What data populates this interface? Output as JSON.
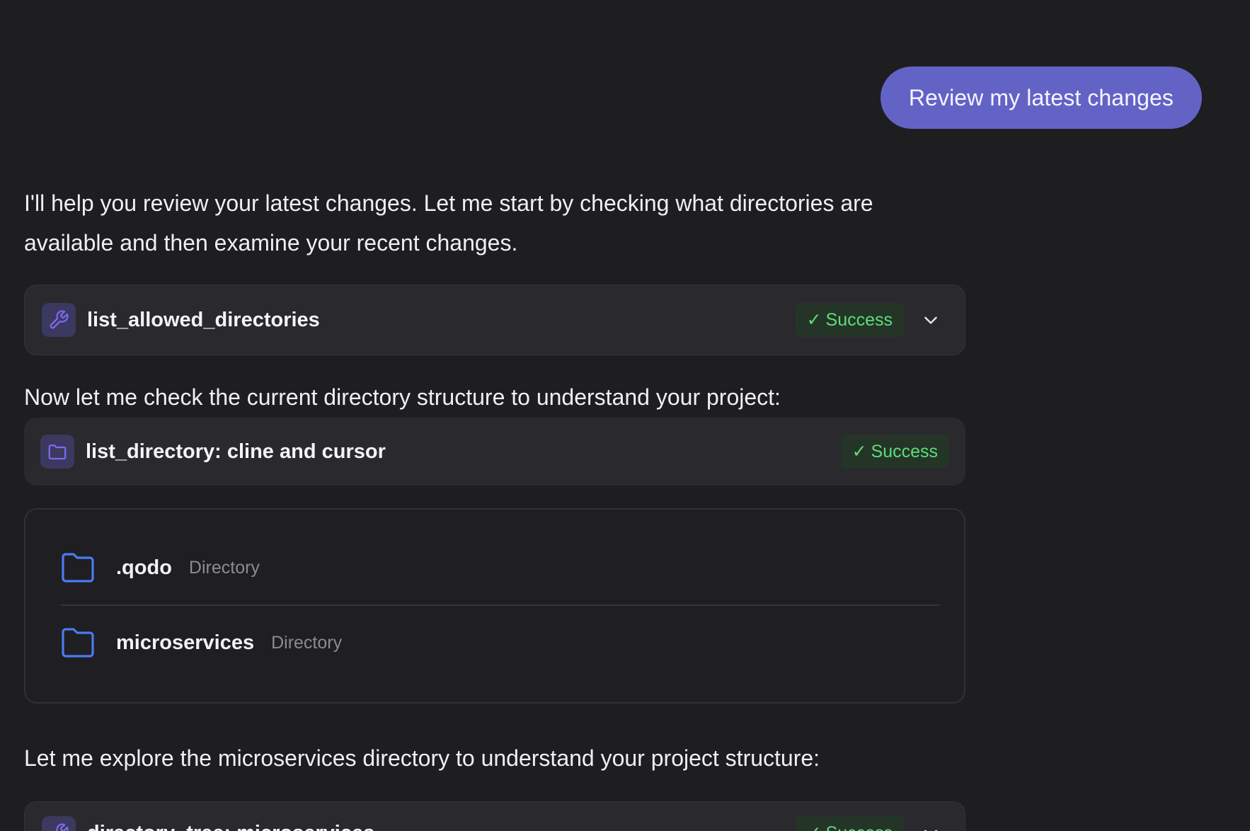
{
  "user_message": "Review my latest changes",
  "messages": {
    "intro": "I'll help you review your latest changes. Let me start by checking what directories are available and then examine your recent changes.",
    "check_structure": "Now let me check the current directory structure to understand your project:",
    "explore": "Let me explore the microservices directory to understand your project structure:"
  },
  "tools": [
    {
      "title": "list_allowed_directories",
      "status": "Success",
      "icon": "wrench-icon"
    },
    {
      "title": "list_directory: cline and cursor",
      "status": "Success",
      "icon": "folder-icon"
    },
    {
      "title": "directory_tree: microservices",
      "status": "Success",
      "icon": "wrench-icon"
    }
  ],
  "status_check": "✓",
  "directory_listing": [
    {
      "name": ".qodo",
      "type": "Directory"
    },
    {
      "name": "microservices",
      "type": "Directory"
    }
  ],
  "colors": {
    "background": "#1e1e20",
    "user_bubble": "#6363c6",
    "success_text": "#5fdc7a",
    "success_bg": "#243527",
    "folder_blue": "#4a7cf0",
    "tool_icon_purple": "#7b6cf0"
  }
}
